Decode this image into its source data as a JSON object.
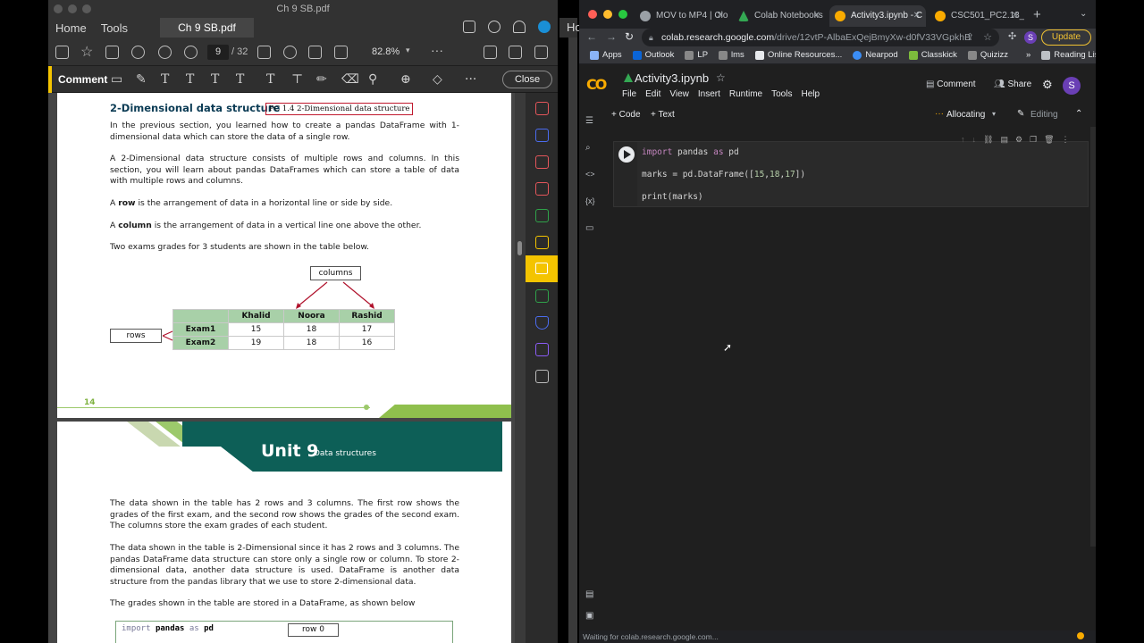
{
  "acrobat": {
    "window_title": "Ch 9 SB.pdf",
    "menu": [
      "Home",
      "Tools"
    ],
    "doc_tab": "Ch 9 SB.pdf",
    "ho_label": "Ho",
    "page_current": "9",
    "page_of": "/ 32",
    "zoom": "82.8%",
    "comment_label": "Comment",
    "close_label": "Close",
    "page1": {
      "heading": "2-Dimensional data structure",
      "pc_box": "PC 1.4 2-Dimensional data structure",
      "p1": "In the previous section, you learned how to create a pandas DataFrame with 1-dimensional data which can store the data of a single row.",
      "p2": "A 2-Dimensional data structure consists of multiple rows and columns. In this section, you will learn about pandas DataFrames which can store a table of data with multiple rows and columns.",
      "p3_bold": "row",
      "p3_pre": "A ",
      "p3_post": " is the arrangement of data in a horizontal line or side by side.",
      "p4_pre": "A ",
      "p4_bold": "column",
      "p4_post": " is the arrangement of data in a vertical line one above the other.",
      "p5": "Two exams grades for 3 students are shown in the table below.",
      "columns_label": "columns",
      "rows_label": "rows",
      "table": {
        "headers": [
          "",
          "Khalid",
          "Noora",
          "Rashid"
        ],
        "rows": [
          [
            "Exam1",
            "15",
            "18",
            "17"
          ],
          [
            "Exam2",
            "19",
            "18",
            "16"
          ]
        ]
      },
      "page_number": "14"
    },
    "page2": {
      "unit": "Unit 9",
      "unit_sub": "Data structures",
      "p1": "The data shown in the table has 2 rows and 3 columns. The first row shows the grades of the first exam, and the second row shows the grades of the second exam. The columns store the exam grades of each student.",
      "p2": "The data shown in the table is 2-Dimensional since it has 2 rows and 3 columns. The pandas DataFrame data structure can store only a single row or column. To store 2-dimensional data, another data structure is used. DataFrame is another data structure from the pandas library that we use to store 2-dimensional data.",
      "p3": "The grades shown in the table are stored in a DataFrame, as shown below",
      "code_kw1": "import",
      "code_mod": "pandas",
      "code_kw2": "as",
      "code_alias": "pd",
      "row0_label": "row 0"
    }
  },
  "chrome": {
    "tabs": [
      {
        "label": "MOV to MP4 | Clo",
        "color": "#9aa0a6"
      },
      {
        "label": "Colab Notebooks",
        "color": "#34a853"
      },
      {
        "label": "Activity3.ipynb - C",
        "color": "#f9ab00"
      },
      {
        "label": "CSC501_PC2.13_",
        "color": "#f9ab00"
      }
    ],
    "url_host": "colab.research.google.com",
    "url_path": "/drive/12vtP-AlbaExQejBmyXw-d0fV33VGpkhB",
    "update_label": "Update",
    "profile_letter": "S",
    "bookmarks": [
      {
        "label": "Apps",
        "color": "#8ab4f8"
      },
      {
        "label": "Outlook",
        "color": "#0a64d6"
      },
      {
        "label": "LP",
        "color": "#888888"
      },
      {
        "label": "lms",
        "color": "#888888"
      },
      {
        "label": "Online Resources...",
        "color": "#e8eaed"
      },
      {
        "label": "Nearpod",
        "color": "#3b8df5"
      },
      {
        "label": "Classkick",
        "color": "#7dbb3c"
      },
      {
        "label": "Quizizz",
        "color": "#888888"
      }
    ],
    "bookmarks_more": "»",
    "reading_list": "Reading List",
    "status": "Waiting for colab.research.google.com..."
  },
  "colab": {
    "logo": "CO",
    "notebook_title": "Activity3.ipynb",
    "menu": [
      "File",
      "Edit",
      "View",
      "Insert",
      "Runtime",
      "Tools",
      "Help"
    ],
    "comment_label": "Comment",
    "share_label": "Share",
    "add_code": "+ Code",
    "add_text": "+ Text",
    "runtime_status": "Allocating",
    "editing_label": "Editing",
    "code_lines": {
      "l1_kw": "import",
      "l1_mod": " pandas ",
      "l1_as": "as",
      "l1_alias": " pd",
      "l2_pre": "marks = pd.DataFrame([",
      "l2_n1": "15",
      "l2_c1": ",",
      "l2_n2": "18",
      "l2_c2": ",",
      "l2_n3": "17",
      "l2_post": "])",
      "l3": "print(marks)"
    }
  }
}
